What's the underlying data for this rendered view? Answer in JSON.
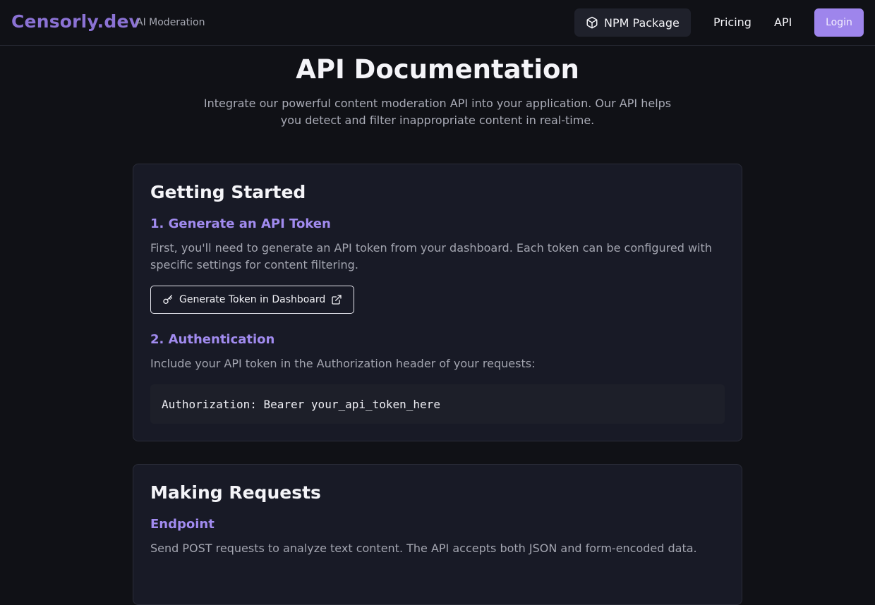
{
  "header": {
    "brand": "Censorly.dev",
    "brand_sub": "AI Moderation",
    "npm_label": "NPM Package",
    "pricing_label": "Pricing",
    "api_label": "API",
    "login_label": "Login"
  },
  "hero": {
    "title": "API Documentation",
    "subtitle": "Integrate our powerful content moderation API into your application. Our API helps you detect and filter inappropriate content in real-time."
  },
  "getting_started": {
    "title": "Getting Started",
    "step1_heading": "1. Generate an API Token",
    "step1_text": "First, you'll need to generate an API token from your dashboard. Each token can be configured with specific settings for content filtering.",
    "token_button_label": "Generate Token in Dashboard",
    "step2_heading": "2. Authentication",
    "step2_text": "Include your API token in the Authorization header of your requests:",
    "auth_code": "Authorization: Bearer your_api_token_here"
  },
  "making_requests": {
    "title": "Making Requests",
    "endpoint_heading": "Endpoint",
    "endpoint_text": "Send POST requests to analyze text content. The API accepts both JSON and form-encoded data."
  },
  "colors": {
    "background": "#101116",
    "card": "#181a26",
    "accent": "#9e85ec",
    "brand": "#8b72d4",
    "heading_accent": "#a18bef"
  },
  "icons": {
    "npm": "package-icon",
    "key": "key-icon",
    "external": "external-link-icon"
  }
}
